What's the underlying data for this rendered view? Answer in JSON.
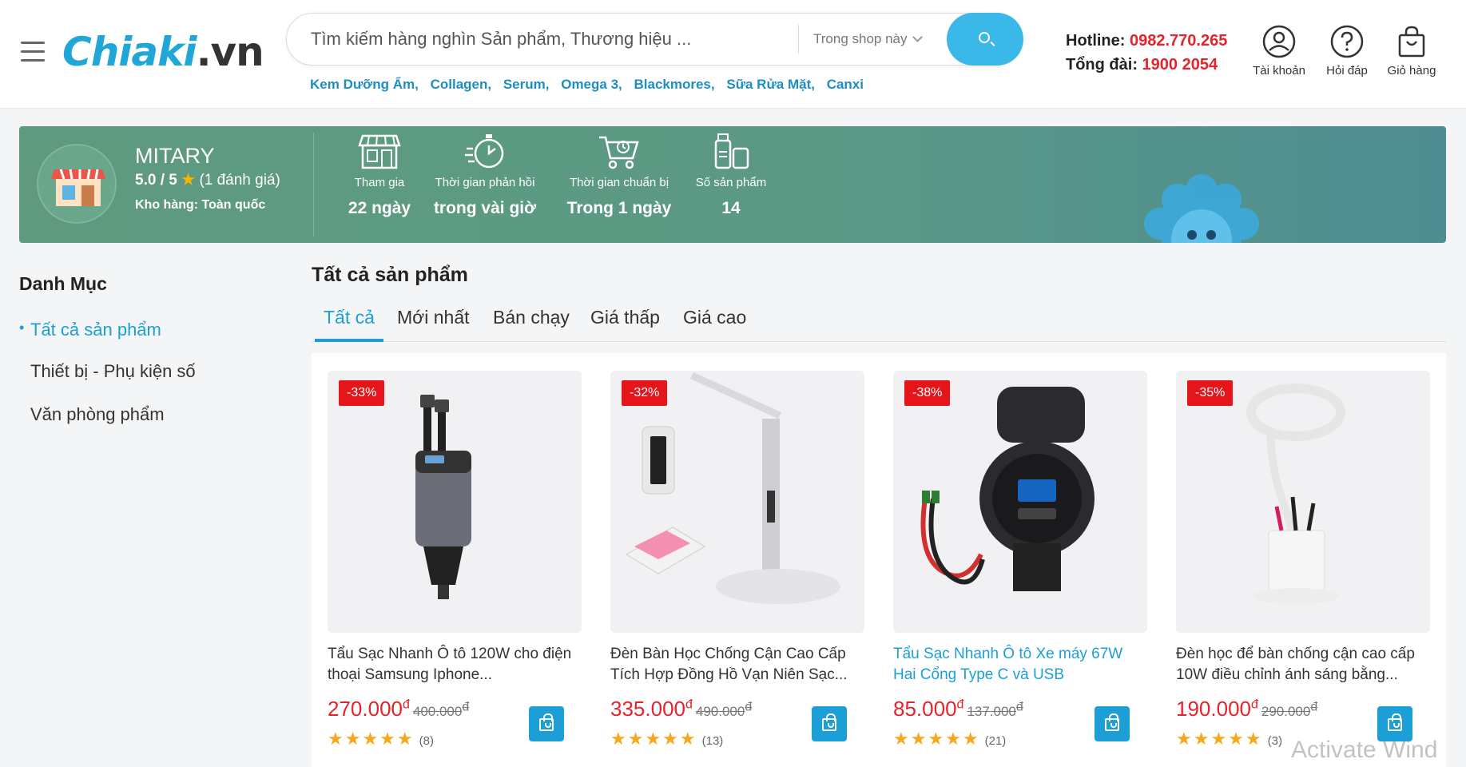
{
  "header": {
    "logo_main": "Chiaki",
    "logo_suffix": ".vn",
    "search_placeholder": "Tìm kiếm hàng nghìn Sản phẩm, Thương hiệu ...",
    "search_scope": "Trong shop này",
    "quick_links": [
      "Kem Dưỡng Ẩm,",
      "Collagen,",
      "Serum,",
      "Omega 3,",
      "Blackmores,",
      "Sữa Rửa Mặt,",
      "Canxi"
    ],
    "hotline_label": "Hotline:",
    "hotline_value": "0982.770.265",
    "switchboard_label": "Tổng đài:",
    "switchboard_value": "1900 2054",
    "account_label": "Tài khoản",
    "faq_label": "Hỏi đáp",
    "cart_label": "Giỏ hàng"
  },
  "shop": {
    "name": "MITARY",
    "rating": "5.0 / 5",
    "rating_count": "(1 đánh giá)",
    "warehouse": "Kho hàng: Toàn quốc",
    "stats": [
      {
        "label": "Tham gia",
        "value": "22 ngày",
        "icon": "storefront-icon"
      },
      {
        "label": "Thời gian phản hồi",
        "value": "trong vài giờ",
        "icon": "fast-clock-icon"
      },
      {
        "label": "Thời gian chuẩn bị",
        "value": "Trong 1 ngày",
        "icon": "cart-clock-icon"
      },
      {
        "label": "Số sản phẩm",
        "value": "14",
        "icon": "products-icon"
      }
    ]
  },
  "sidebar": {
    "title": "Danh Mục",
    "items": [
      {
        "label": "Tất cả sản phẩm",
        "active": true
      },
      {
        "label": "Thiết bị - Phụ kiện số",
        "active": false
      },
      {
        "label": "Văn phòng phẩm",
        "active": false
      }
    ]
  },
  "main": {
    "title": "Tất cả sản phẩm",
    "tabs": [
      "Tất cả",
      "Mới nhất",
      "Bán chạy",
      "Giá thấp",
      "Giá cao"
    ],
    "active_tab": "Tất cả"
  },
  "products": [
    {
      "discount": "-33%",
      "title": "Tẩu Sạc Nhanh Ô tô 120W cho điện thoại Samsung Iphone...",
      "price": "270.000",
      "currency": "đ",
      "old_price": "400.000",
      "old_currency": "đ",
      "stars": "★★★★★",
      "reviews": "(8)",
      "highlight": false
    },
    {
      "discount": "-32%",
      "title": "Đèn Bàn Học Chống Cận Cao Cấp Tích Hợp Đồng Hồ Vạn Niên Sạc...",
      "price": "335.000",
      "currency": "đ",
      "old_price": "490.000",
      "old_currency": "đ",
      "stars": "★★★★★",
      "reviews": "(13)",
      "highlight": false
    },
    {
      "discount": "-38%",
      "title": "Tẩu Sạc Nhanh Ô tô Xe máy 67W Hai Cổng Type C và USB",
      "price": "85.000",
      "currency": "đ",
      "old_price": "137.000",
      "old_currency": "đ",
      "stars": "★★★★★",
      "reviews": "(21)",
      "highlight": true
    },
    {
      "discount": "-35%",
      "title": "Đèn học để bàn chống cận cao cấp 10W điều chỉnh ánh sáng bằng...",
      "price": "190.000",
      "currency": "đ",
      "old_price": "290.000",
      "old_currency": "đ",
      "stars": "★★★★★",
      "reviews": "(3)",
      "highlight": false
    }
  ],
  "watermark": "Activate Wind",
  "colors": {
    "brand": "#20a7d8",
    "price": "#e4232b",
    "banner": "#5b9984",
    "badge": "#e4161c"
  }
}
